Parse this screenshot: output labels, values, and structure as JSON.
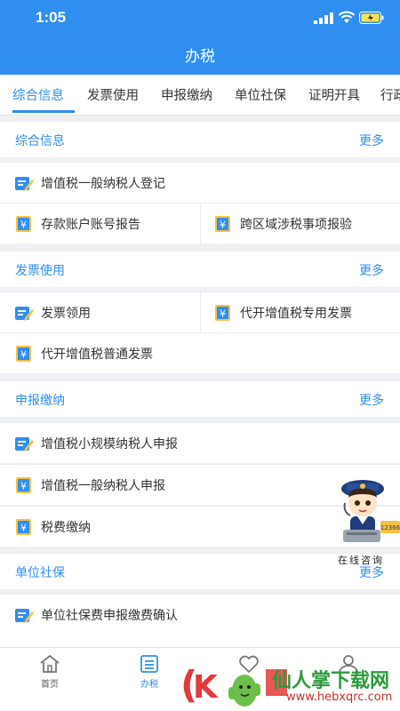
{
  "status": {
    "time": "1:05"
  },
  "header": {
    "title": "办税"
  },
  "tabs": [
    {
      "label": "综合信息",
      "active": true
    },
    {
      "label": "发票使用",
      "active": false
    },
    {
      "label": "申报缴纳",
      "active": false
    },
    {
      "label": "单位社保",
      "active": false
    },
    {
      "label": "证明开具",
      "active": false
    },
    {
      "label": "行政",
      "active": false
    }
  ],
  "sections": [
    {
      "title": "综合信息",
      "more": "更多",
      "items": [
        {
          "label": "增值税一般纳税人登记",
          "icon": "edit-form-icon"
        },
        {
          "label": "存款账户账号报告",
          "icon": "yuan-doc-icon"
        },
        {
          "label": "跨区域涉税事项报验",
          "icon": "yuan-doc-icon"
        }
      ]
    },
    {
      "title": "发票使用",
      "more": "更多",
      "items": [
        {
          "label": "发票领用",
          "icon": "edit-form-icon"
        },
        {
          "label": "代开增值税专用发票",
          "icon": "yuan-doc-icon"
        },
        {
          "label": "代开增值税普通发票",
          "icon": "yuan-doc-icon"
        }
      ]
    },
    {
      "title": "申报缴纳",
      "more": "更多",
      "items": [
        {
          "label": "增值税小规模纳税人申报",
          "icon": "edit-form-icon"
        },
        {
          "label": "增值税一般纳税人申报",
          "icon": "yuan-doc-icon"
        },
        {
          "label": "税费缴纳",
          "icon": "yuan-doc-icon"
        }
      ]
    },
    {
      "title": "单位社保",
      "more": "更多",
      "items": [
        {
          "label": "单位社保费申报缴费确认",
          "icon": "edit-form-icon"
        }
      ]
    }
  ],
  "consult": {
    "label": "在线咨询",
    "badge": "12366"
  },
  "tabbar": [
    {
      "label": "首页",
      "icon": "home-icon",
      "active": false
    },
    {
      "label": "办税",
      "icon": "list-icon",
      "active": true
    },
    {
      "label": "",
      "icon": "heart-icon",
      "active": false
    },
    {
      "label": "",
      "icon": "user-icon",
      "active": false
    }
  ],
  "watermark": {
    "text": "仙人掌下载网",
    "url": "www.hebxqrc.com"
  },
  "colors": {
    "primary": "#2f8ef0",
    "icon_yellow": "#f5c242",
    "background": "#eef0f3"
  }
}
